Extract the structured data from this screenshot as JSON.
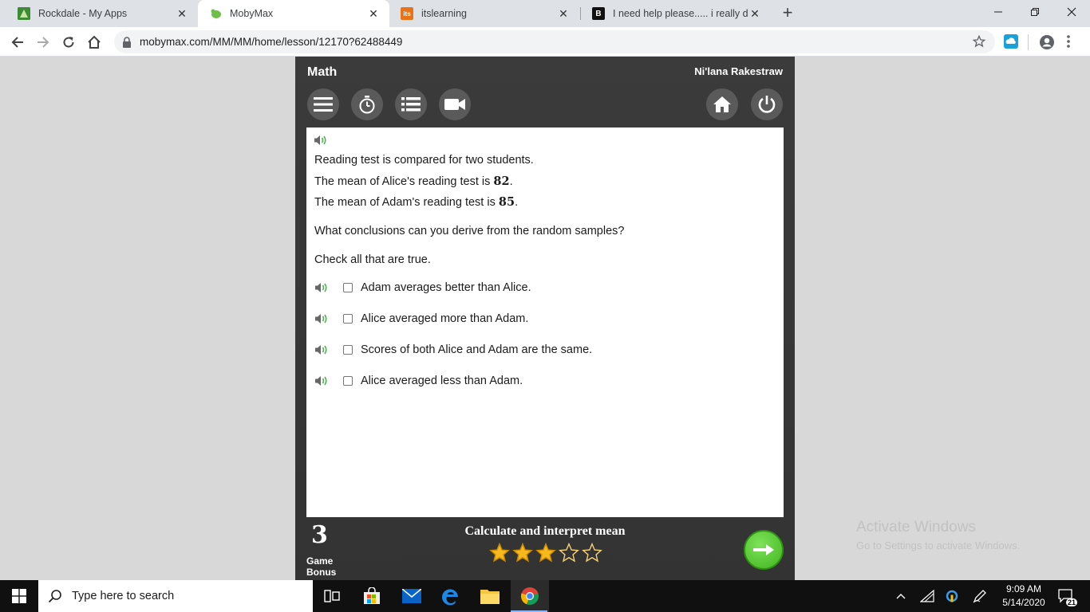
{
  "browser": {
    "tabs": [
      {
        "title": "Rockdale - My Apps",
        "icon": "rockdale-favicon-icon",
        "active": false
      },
      {
        "title": "MobyMax",
        "icon": "mobymax-favicon-icon",
        "active": true
      },
      {
        "title": "itslearning",
        "icon": "itslearning-favicon-icon",
        "favicon_text": "its",
        "active": false
      },
      {
        "title": "I need help please..... i really do n",
        "icon": "brainly-favicon-icon",
        "favicon_text": "B",
        "active": false
      }
    ],
    "url": "mobymax.com/MM/MM/home/lesson/12170?62488449"
  },
  "app": {
    "subject": "Math",
    "student_name": "Ni'lana Rakestraw",
    "toolbar_icons": [
      "menu-icon",
      "stopwatch-icon",
      "list-icon",
      "video-icon",
      "home-icon",
      "power-icon"
    ]
  },
  "question": {
    "line1": "Reading test is compared for two students.",
    "line2_prefix": "The mean of Alice's reading test is ",
    "line2_value": "82",
    "line2_suffix": ".",
    "line3_prefix": "The mean of Adam's reading test is ",
    "line3_value": "85",
    "line3_suffix": ".",
    "prompt": "What conclusions can you derive from the random samples?",
    "instruction": "Check all that are true.",
    "options": [
      {
        "label": "Adam averages better than Alice.",
        "checked": false
      },
      {
        "label": "Alice averaged more than Adam.",
        "checked": false
      },
      {
        "label": "Scores of both Alice and Adam are the same.",
        "checked": false
      },
      {
        "label": "Alice averaged less than Adam.",
        "checked": false
      }
    ]
  },
  "footer": {
    "game_bonus_count": "3",
    "game_label": "Game",
    "bonus_label": "Bonus",
    "lesson_title": "Calculate and interpret mean",
    "rating": {
      "filled": 3,
      "total": 5
    }
  },
  "watermark": {
    "title": "Activate Windows",
    "subtitle": "Go to Settings to activate Windows."
  },
  "taskbar": {
    "search_placeholder": "Type here to search",
    "time": "9:09 AM",
    "date": "5/14/2020",
    "notification_count": "21"
  },
  "colors": {
    "accent_green": "#3fb51e",
    "star_gold": "#f6b81c",
    "app_bg": "#383838"
  }
}
